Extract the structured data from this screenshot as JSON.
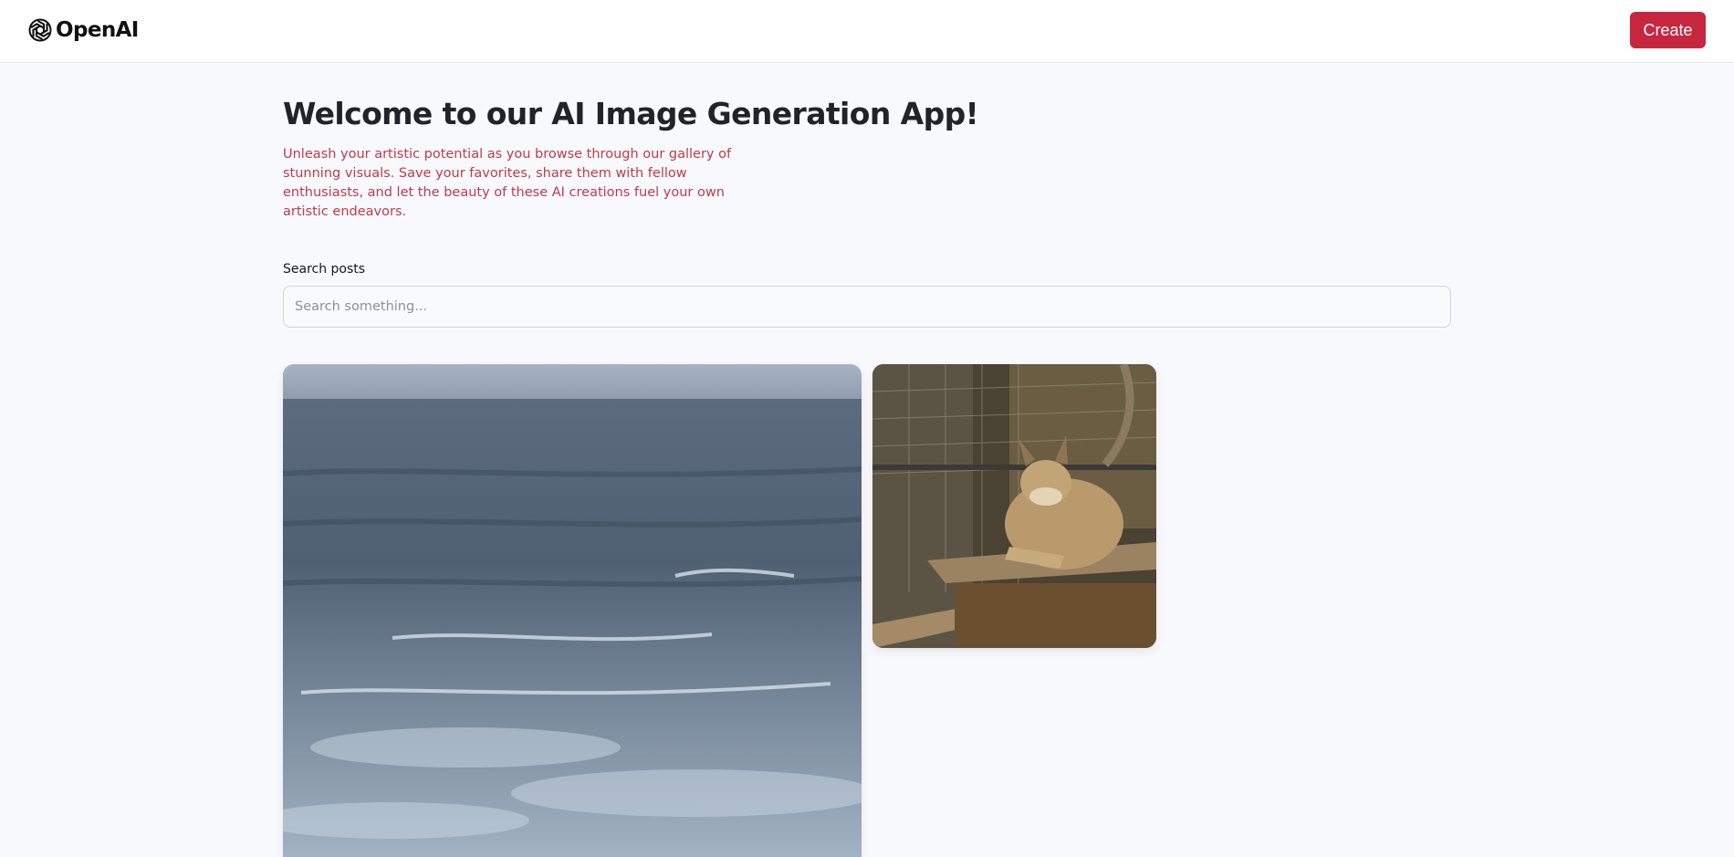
{
  "header": {
    "logo_text": "OpenAI",
    "create_label": "Create"
  },
  "hero": {
    "title": "Welcome to our AI Image Generation App!",
    "subtitle": "Unleash your artistic potential as you browse through our gallery of stunning visuals. Save your favorites, share them with fellow enthusiasts, and let the beauty of these AI creations fuel your own artistic endeavors."
  },
  "search": {
    "label": "Search posts",
    "placeholder": "Search something...",
    "value": ""
  },
  "gallery": {
    "posts": [
      {
        "subject": "ocean-waves"
      },
      {
        "subject": "bobcat"
      }
    ]
  },
  "colors": {
    "accent": "#c7263f",
    "subtitle": "#c13a4a",
    "background": "#f8f9fc"
  },
  "icons": {
    "logo": "openai-logo-icon"
  }
}
